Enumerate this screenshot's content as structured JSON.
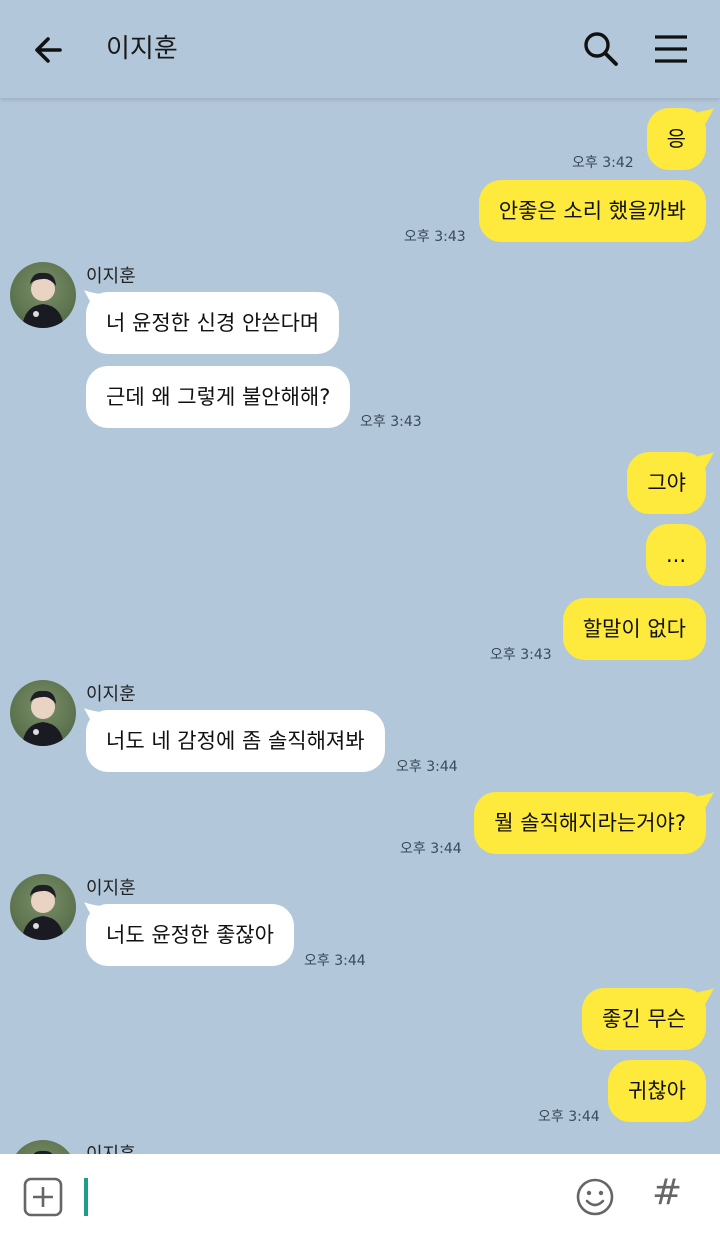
{
  "header": {
    "title": "이지훈",
    "back_icon": "arrow-left-icon",
    "search_icon": "search-icon",
    "menu_icon": "hamburger-menu-icon"
  },
  "messages": [
    {
      "from": "me",
      "text": "응",
      "time": "오후 3:42"
    },
    {
      "from": "me",
      "text": "안좋은 소리 했을까봐",
      "time": "오후 3:43"
    },
    {
      "from": "other",
      "sender": "이지훈",
      "text": "너 윤정한 신경 안쓴다며"
    },
    {
      "from": "other",
      "text": "근데 왜 그렇게 불안해해?",
      "time": "오후 3:43"
    },
    {
      "from": "me",
      "text": "그야"
    },
    {
      "from": "me",
      "text": "..."
    },
    {
      "from": "me",
      "text": "할말이 없다",
      "time": "오후 3:43"
    },
    {
      "from": "other",
      "sender": "이지훈",
      "text": "너도 네 감정에 좀 솔직해져봐",
      "time": "오후 3:44"
    },
    {
      "from": "me",
      "text": "뭘 솔직해지라는거야?",
      "time": "오후 3:44"
    },
    {
      "from": "other",
      "sender": "이지훈",
      "text": "너도 윤정한 좋잖아",
      "time": "오후 3:44"
    },
    {
      "from": "me",
      "text": "좋긴 무슨"
    },
    {
      "from": "me",
      "text": "귀찮아",
      "time": "오후 3:44"
    },
    {
      "from": "other",
      "sender": "이지훈"
    }
  ],
  "input": {
    "plus_icon": "plus-square-icon",
    "emoji_icon": "emoji-icon",
    "hash_label": "#"
  },
  "colors": {
    "background": "#b2c7da",
    "my_bubble": "#fee93d",
    "other_bubble": "#ffffff",
    "cursor": "#1e9d8b"
  }
}
